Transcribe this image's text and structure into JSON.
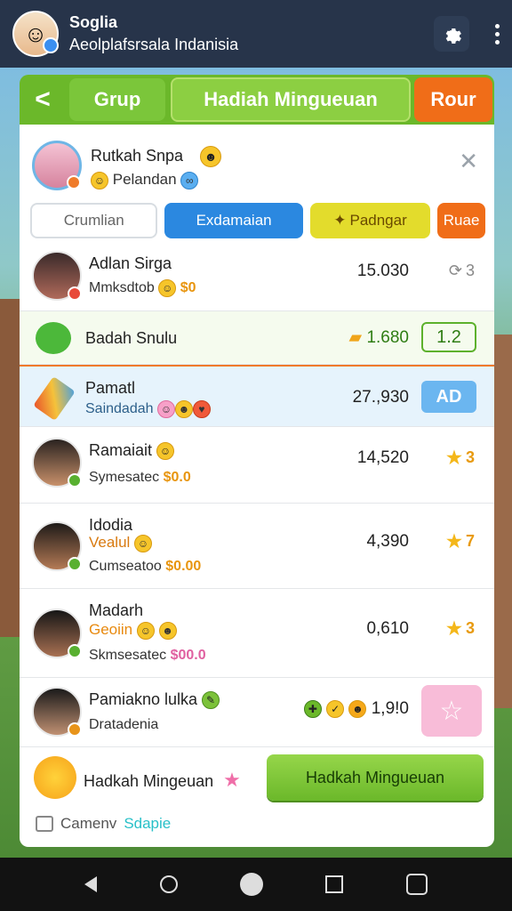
{
  "topbar": {
    "title": "Soglia",
    "subtitle": "Aeolplafsrsala Indanisia",
    "settings_icon": "gear-icon",
    "more_icon": "kebab-menu-icon"
  },
  "tabs": {
    "back": "<",
    "grup": "Grup",
    "hadiah": "Hadiah Mingueuan",
    "rour": "Rour"
  },
  "profile": {
    "name": "Rutkah Snpa",
    "sub": "Pelandan"
  },
  "filters": [
    "Crumlian",
    "Exdamaian",
    "Padngar",
    "Ruae"
  ],
  "rows": [
    {
      "name": "Adlan Sirga",
      "sub": "Mmksdtob",
      "amount": "$0",
      "score": "15.030",
      "badge": "3"
    },
    {
      "name": "Badah Snulu",
      "score": "1.680",
      "badge": "1.2"
    },
    {
      "name": "Pamatl",
      "sub": "Saindadah",
      "score": "27.,930",
      "badge": "AD"
    },
    {
      "name": "Ramaiait",
      "sub": "Symesatec",
      "amount": "$0.0",
      "score": "14,520",
      "badge": "3"
    },
    {
      "name": "Idodia",
      "tag": "Vealul",
      "sub": "Cumseatoo",
      "amount": "$0.00",
      "score": "4,390",
      "badge": "7"
    },
    {
      "name": "Madarh",
      "tag": "Geoiin",
      "sub": "Skmsesatec",
      "amount": "$00.0",
      "score": "0,610",
      "badge": "3"
    },
    {
      "name": "Pamiakno lulka",
      "sub": "Dratadenia",
      "score": "1,9!0"
    }
  ],
  "footer": {
    "label": "Hadkah Mingeuan",
    "button": "Hadkah Mingueuan"
  },
  "bottom_link": {
    "prefix": "Camenv",
    "link": "Sdapie"
  },
  "colors": {
    "topbar": "#27344a",
    "green": "#6bb82a",
    "orange": "#f06d18",
    "blue": "#2b88e0"
  }
}
